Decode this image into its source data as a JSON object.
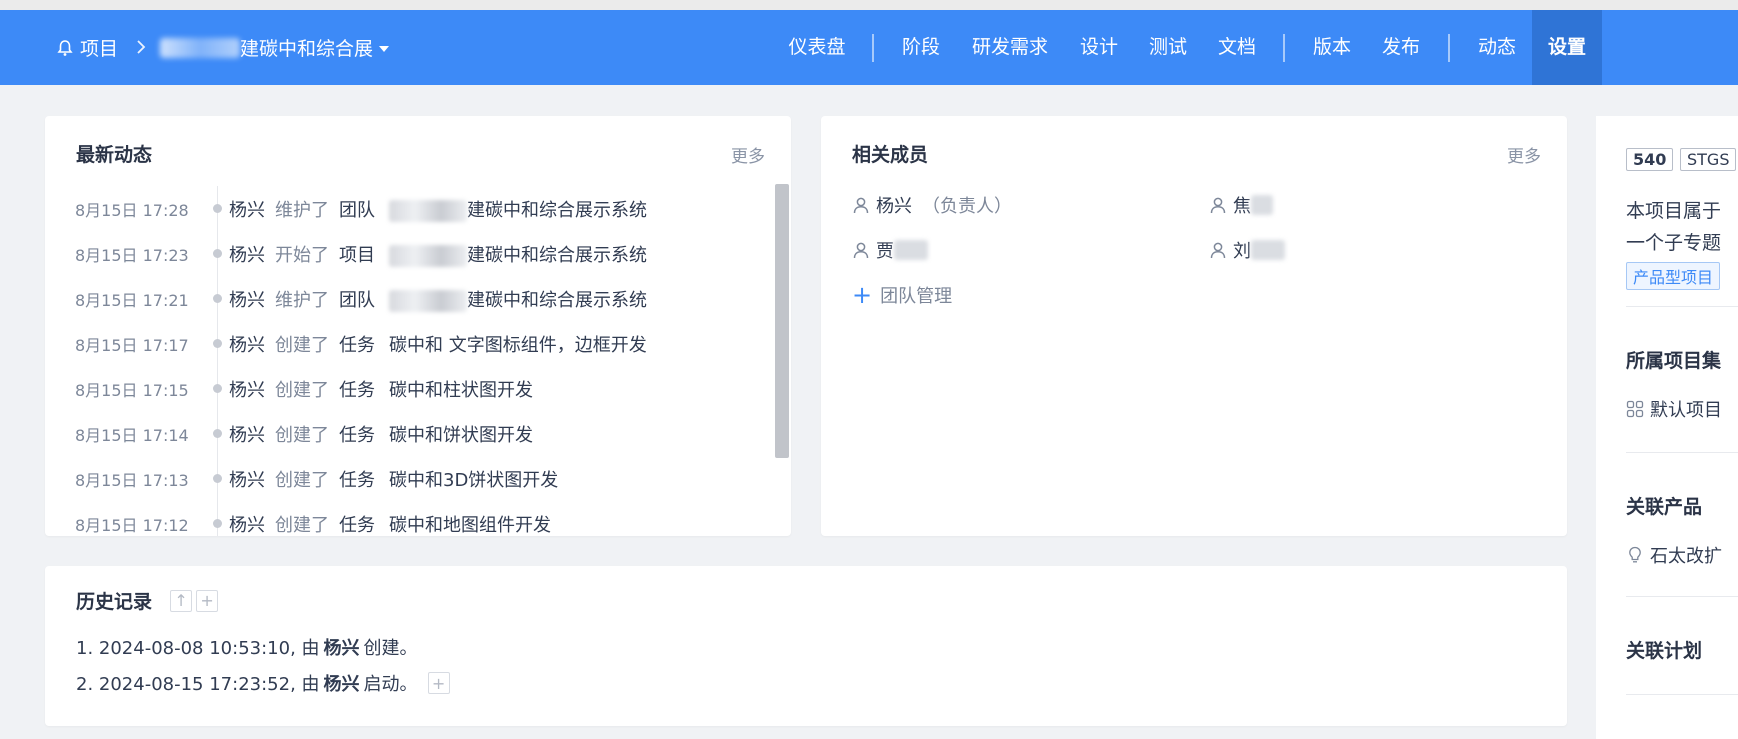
{
  "header": {
    "breadcrumb_root": "项目",
    "project_name_suffix": "建碳中和综合展",
    "nav": {
      "dashboard": "仪表盘",
      "stage": "阶段",
      "requirements": "研发需求",
      "design": "设计",
      "testing": "测试",
      "docs": "文档",
      "version": "版本",
      "release": "发布",
      "activity": "动态",
      "settings": "设置"
    }
  },
  "activity": {
    "title": "最新动态",
    "more": "更多",
    "rows": [
      {
        "time": "8月15日 17:28",
        "user": "杨兴",
        "verb": "维护了",
        "kind": "团队",
        "target": "建碳中和综合展示系统",
        "blurred": true
      },
      {
        "time": "8月15日 17:23",
        "user": "杨兴",
        "verb": "开始了",
        "kind": "项目",
        "target": "建碳中和综合展示系统",
        "blurred": true
      },
      {
        "time": "8月15日 17:21",
        "user": "杨兴",
        "verb": "维护了",
        "kind": "团队",
        "target": "建碳中和综合展示系统",
        "blurred": true
      },
      {
        "time": "8月15日 17:17",
        "user": "杨兴",
        "verb": "创建了",
        "kind": "任务",
        "target": "碳中和 文字图标组件，边框开发",
        "blurred": false
      },
      {
        "time": "8月15日 17:15",
        "user": "杨兴",
        "verb": "创建了",
        "kind": "任务",
        "target": "碳中和柱状图开发",
        "blurred": false
      },
      {
        "time": "8月15日 17:14",
        "user": "杨兴",
        "verb": "创建了",
        "kind": "任务",
        "target": "碳中和饼状图开发",
        "blurred": false
      },
      {
        "time": "8月15日 17:13",
        "user": "杨兴",
        "verb": "创建了",
        "kind": "任务",
        "target": "碳中和3D饼状图开发",
        "blurred": false
      },
      {
        "time": "8月15日 17:12",
        "user": "杨兴",
        "verb": "创建了",
        "kind": "任务",
        "target": "碳中和地图组件开发",
        "blurred": false
      }
    ]
  },
  "members": {
    "title": "相关成员",
    "more": "更多",
    "list": [
      {
        "name": "杨兴",
        "role": "（负责人）"
      },
      {
        "name": "焦",
        "role": ""
      },
      {
        "name": "贾",
        "role": ""
      },
      {
        "name": "刘",
        "role": ""
      }
    ],
    "team_manage": "团队管理"
  },
  "history": {
    "title": "历史记录",
    "lines": [
      {
        "prefix": "1. 2024-08-08 10:53:10, 由",
        "user": "杨兴",
        "suffix": "创建。"
      },
      {
        "prefix": "2. 2024-08-15 17:23:52, 由",
        "user": "杨兴",
        "suffix": "启动。"
      }
    ]
  },
  "side": {
    "id_tag": "540",
    "code_tag": "STGS",
    "desc_line1": "本项目属于",
    "desc_line2": "一个子专题",
    "type_tag": "产品型项目",
    "program_title": "所属项目集",
    "program_value": "默认项目",
    "product_title": "关联产品",
    "product_value": "石太改扩",
    "plan_title": "关联计划"
  },
  "colors": {
    "header_bg": "#3d8af7",
    "header_active": "#2f74d6",
    "page_bg": "#f0f2f5",
    "accent": "#3d8af7"
  }
}
